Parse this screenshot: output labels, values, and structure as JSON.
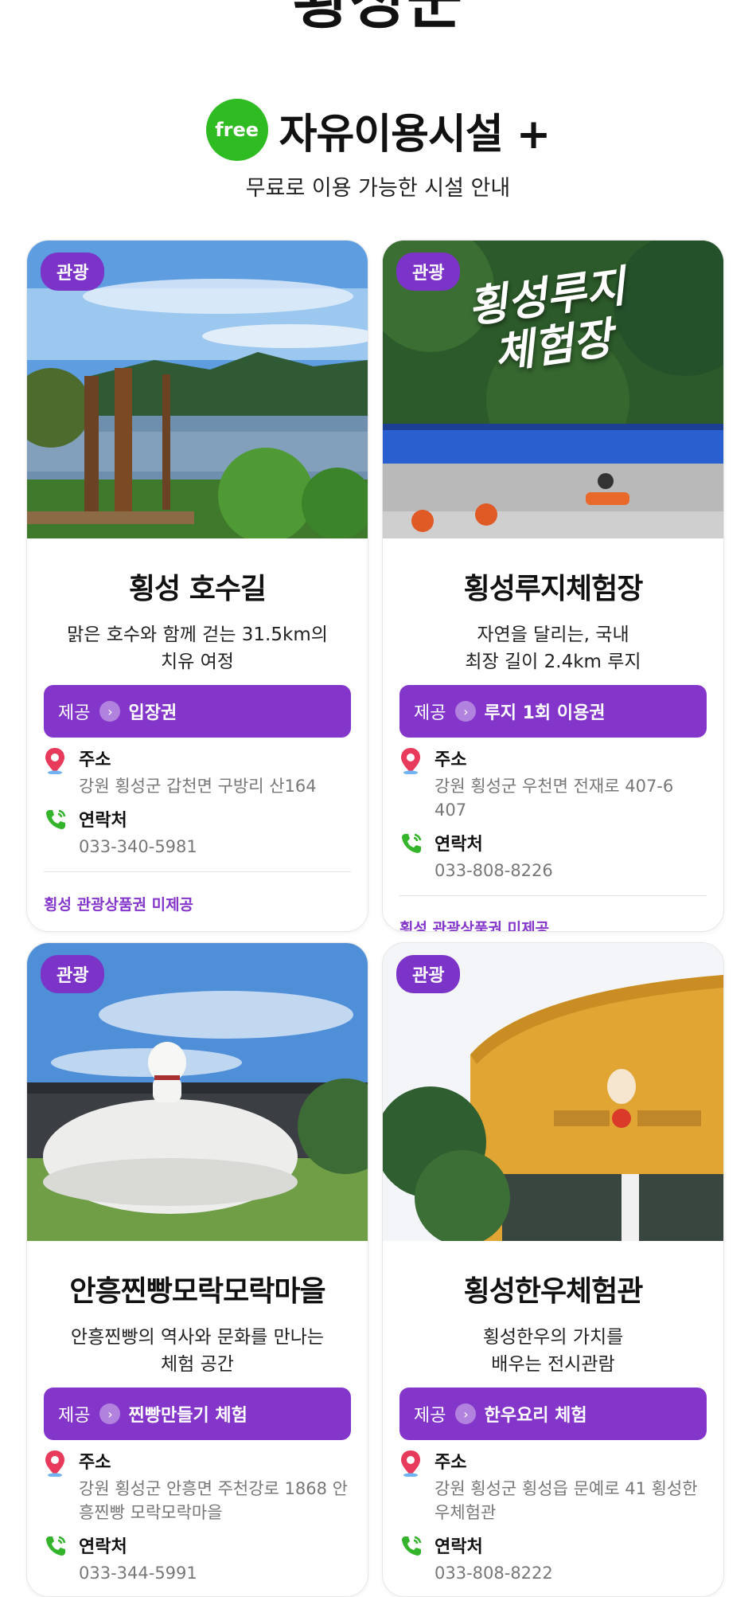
{
  "header": {
    "region_title": "횡성군",
    "free_badge": "free",
    "section_title": "자유이용시설 +",
    "section_subtitle": "무료로 이용 가능한 시설 안내"
  },
  "colors": {
    "accent_purple": "#8436cb",
    "badge_green": "#2fbb22",
    "pin_red": "#e83a5a",
    "phone_green": "#33b42a"
  },
  "icons": {
    "address": "location-pin-icon",
    "phone": "phone-icon",
    "offer": "chevron-right-icon"
  },
  "cards": [
    {
      "category": "관광",
      "photo_text": "",
      "name": "횡성 호수길",
      "description": "맑은 호수와 함께 걷는 31.5km의\n치유 여정",
      "offer_label": "제공",
      "offer_item": "입장권",
      "address_label": "주소",
      "address": "강원 횡성군 갑천면 구방리 산164",
      "phone_label": "연락처",
      "phone": "033-340-5981",
      "voucher_note": "횡성 관광상품권 미제공"
    },
    {
      "category": "관광",
      "photo_text": "횡성루지 체험장",
      "name": "횡성루지체험장",
      "description": "자연을 달리는, 국내\n최장 길이 2.4km 루지",
      "offer_label": "제공",
      "offer_item": "루지 1회 이용권",
      "address_label": "주소",
      "address": "강원 횡성군 우천면 전재로 407-6 407",
      "phone_label": "연락처",
      "phone": "033-808-8226",
      "voucher_note": "횡성 관광상품권 미제공"
    },
    {
      "category": "관광",
      "photo_text": "",
      "name": "안흥찐빵모락모락마을",
      "description": "안흥찐빵의 역사와 문화를 만나는\n체험 공간",
      "offer_label": "제공",
      "offer_item": "찐빵만들기 체험",
      "address_label": "주소",
      "address": "강원 횡성군 안흥면 주천강로 1868 안흥찐빵 모락모락마을",
      "phone_label": "연락처",
      "phone": "033-344-5991"
    },
    {
      "category": "관광",
      "photo_text": "",
      "name": "횡성한우체험관",
      "description": "횡성한우의 가치를\n배우는 전시관람",
      "offer_label": "제공",
      "offer_item": "한우요리 체험",
      "address_label": "주소",
      "address": "강원 횡성군 횡성읍 문예로 41 횡성한우체험관",
      "phone_label": "연락처",
      "phone": "033-808-8222"
    }
  ]
}
